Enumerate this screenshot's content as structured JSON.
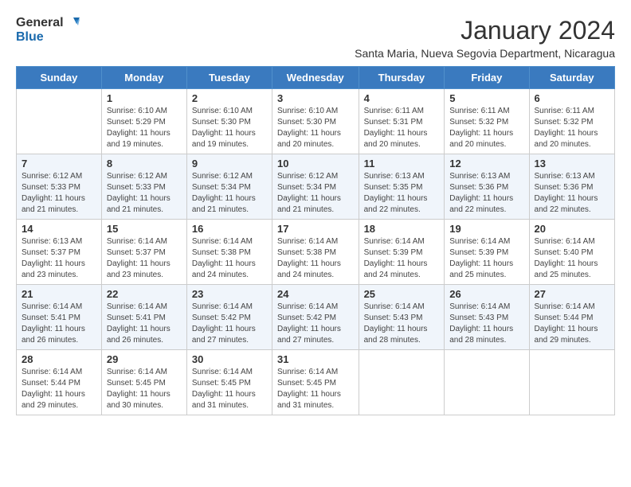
{
  "logo": {
    "general": "General",
    "blue": "Blue"
  },
  "title": "January 2024",
  "subtitle": "Santa Maria, Nueva Segovia Department, Nicaragua",
  "days_of_week": [
    "Sunday",
    "Monday",
    "Tuesday",
    "Wednesday",
    "Thursday",
    "Friday",
    "Saturday"
  ],
  "weeks": [
    [
      {
        "day": "",
        "info": ""
      },
      {
        "day": "1",
        "info": "Sunrise: 6:10 AM\nSunset: 5:29 PM\nDaylight: 11 hours\nand 19 minutes."
      },
      {
        "day": "2",
        "info": "Sunrise: 6:10 AM\nSunset: 5:30 PM\nDaylight: 11 hours\nand 19 minutes."
      },
      {
        "day": "3",
        "info": "Sunrise: 6:10 AM\nSunset: 5:30 PM\nDaylight: 11 hours\nand 20 minutes."
      },
      {
        "day": "4",
        "info": "Sunrise: 6:11 AM\nSunset: 5:31 PM\nDaylight: 11 hours\nand 20 minutes."
      },
      {
        "day": "5",
        "info": "Sunrise: 6:11 AM\nSunset: 5:32 PM\nDaylight: 11 hours\nand 20 minutes."
      },
      {
        "day": "6",
        "info": "Sunrise: 6:11 AM\nSunset: 5:32 PM\nDaylight: 11 hours\nand 20 minutes."
      }
    ],
    [
      {
        "day": "7",
        "info": "Sunrise: 6:12 AM\nSunset: 5:33 PM\nDaylight: 11 hours\nand 21 minutes."
      },
      {
        "day": "8",
        "info": "Sunrise: 6:12 AM\nSunset: 5:33 PM\nDaylight: 11 hours\nand 21 minutes."
      },
      {
        "day": "9",
        "info": "Sunrise: 6:12 AM\nSunset: 5:34 PM\nDaylight: 11 hours\nand 21 minutes."
      },
      {
        "day": "10",
        "info": "Sunrise: 6:12 AM\nSunset: 5:34 PM\nDaylight: 11 hours\nand 21 minutes."
      },
      {
        "day": "11",
        "info": "Sunrise: 6:13 AM\nSunset: 5:35 PM\nDaylight: 11 hours\nand 22 minutes."
      },
      {
        "day": "12",
        "info": "Sunrise: 6:13 AM\nSunset: 5:36 PM\nDaylight: 11 hours\nand 22 minutes."
      },
      {
        "day": "13",
        "info": "Sunrise: 6:13 AM\nSunset: 5:36 PM\nDaylight: 11 hours\nand 22 minutes."
      }
    ],
    [
      {
        "day": "14",
        "info": "Sunrise: 6:13 AM\nSunset: 5:37 PM\nDaylight: 11 hours\nand 23 minutes."
      },
      {
        "day": "15",
        "info": "Sunrise: 6:14 AM\nSunset: 5:37 PM\nDaylight: 11 hours\nand 23 minutes."
      },
      {
        "day": "16",
        "info": "Sunrise: 6:14 AM\nSunset: 5:38 PM\nDaylight: 11 hours\nand 24 minutes."
      },
      {
        "day": "17",
        "info": "Sunrise: 6:14 AM\nSunset: 5:38 PM\nDaylight: 11 hours\nand 24 minutes."
      },
      {
        "day": "18",
        "info": "Sunrise: 6:14 AM\nSunset: 5:39 PM\nDaylight: 11 hours\nand 24 minutes."
      },
      {
        "day": "19",
        "info": "Sunrise: 6:14 AM\nSunset: 5:39 PM\nDaylight: 11 hours\nand 25 minutes."
      },
      {
        "day": "20",
        "info": "Sunrise: 6:14 AM\nSunset: 5:40 PM\nDaylight: 11 hours\nand 25 minutes."
      }
    ],
    [
      {
        "day": "21",
        "info": "Sunrise: 6:14 AM\nSunset: 5:41 PM\nDaylight: 11 hours\nand 26 minutes."
      },
      {
        "day": "22",
        "info": "Sunrise: 6:14 AM\nSunset: 5:41 PM\nDaylight: 11 hours\nand 26 minutes."
      },
      {
        "day": "23",
        "info": "Sunrise: 6:14 AM\nSunset: 5:42 PM\nDaylight: 11 hours\nand 27 minutes."
      },
      {
        "day": "24",
        "info": "Sunrise: 6:14 AM\nSunset: 5:42 PM\nDaylight: 11 hours\nand 27 minutes."
      },
      {
        "day": "25",
        "info": "Sunrise: 6:14 AM\nSunset: 5:43 PM\nDaylight: 11 hours\nand 28 minutes."
      },
      {
        "day": "26",
        "info": "Sunrise: 6:14 AM\nSunset: 5:43 PM\nDaylight: 11 hours\nand 28 minutes."
      },
      {
        "day": "27",
        "info": "Sunrise: 6:14 AM\nSunset: 5:44 PM\nDaylight: 11 hours\nand 29 minutes."
      }
    ],
    [
      {
        "day": "28",
        "info": "Sunrise: 6:14 AM\nSunset: 5:44 PM\nDaylight: 11 hours\nand 29 minutes."
      },
      {
        "day": "29",
        "info": "Sunrise: 6:14 AM\nSunset: 5:45 PM\nDaylight: 11 hours\nand 30 minutes."
      },
      {
        "day": "30",
        "info": "Sunrise: 6:14 AM\nSunset: 5:45 PM\nDaylight: 11 hours\nand 31 minutes."
      },
      {
        "day": "31",
        "info": "Sunrise: 6:14 AM\nSunset: 5:45 PM\nDaylight: 11 hours\nand 31 minutes."
      },
      {
        "day": "",
        "info": ""
      },
      {
        "day": "",
        "info": ""
      },
      {
        "day": "",
        "info": ""
      }
    ]
  ]
}
